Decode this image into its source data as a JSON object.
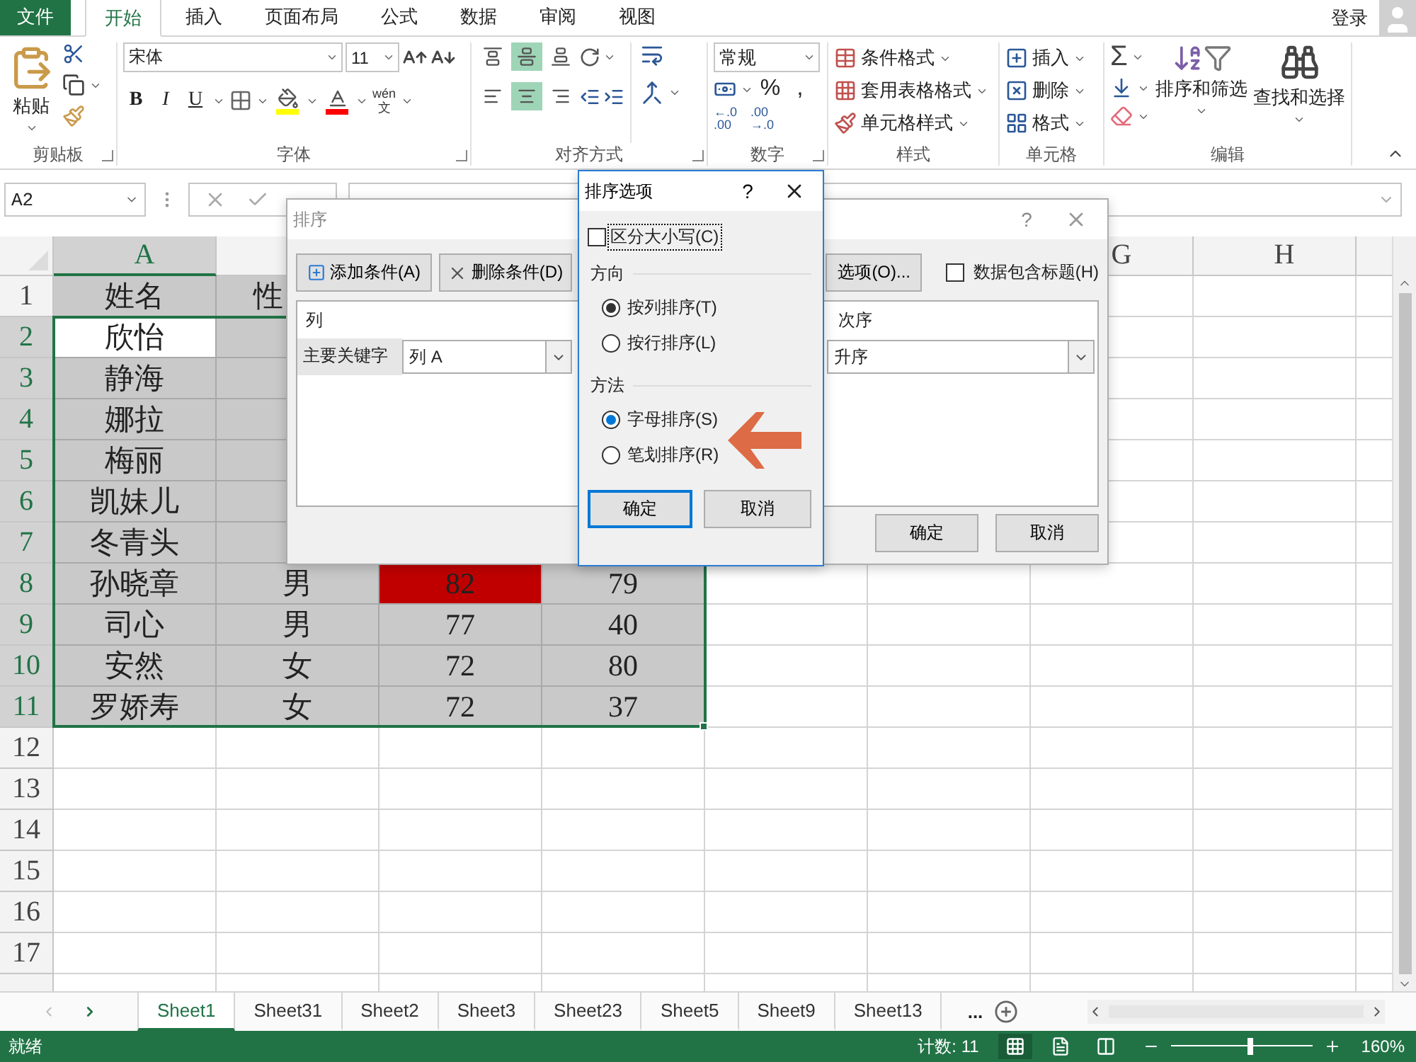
{
  "menu_tabs": [
    {
      "label": "文件",
      "kind": "file",
      "selected": false
    },
    {
      "label": "开始",
      "kind": "tab",
      "selected": true
    },
    {
      "label": "插入",
      "kind": "tab",
      "selected": false
    },
    {
      "label": "页面布局",
      "kind": "tab",
      "selected": false
    },
    {
      "label": "公式",
      "kind": "tab",
      "selected": false
    },
    {
      "label": "数据",
      "kind": "tab",
      "selected": false
    },
    {
      "label": "审阅",
      "kind": "tab",
      "selected": false
    },
    {
      "label": "视图",
      "kind": "tab",
      "selected": false
    }
  ],
  "account": {
    "label": "登录"
  },
  "ribbon": {
    "clipboard": {
      "label": "剪贴板",
      "paste": "粘贴"
    },
    "font": {
      "label": "字体",
      "font_name": "宋体",
      "font_size": "11",
      "bold": "B",
      "italic": "I",
      "underline": "U",
      "phonetic_top": "wén",
      "phonetic_bottom": "文"
    },
    "alignment": {
      "label": "对齐方式",
      "vertical_align": [
        false,
        true,
        false
      ],
      "horizontal_align": [
        false,
        true,
        false
      ]
    },
    "number": {
      "label": "数字",
      "format": "常规",
      "percent": "%",
      "comma": ",",
      "decimals": [
        {
          "top": "←.0",
          "bottom": ".00"
        },
        {
          "top": ".00",
          "bottom": "→.0"
        }
      ]
    },
    "styles": {
      "label": "样式",
      "items": [
        "条件格式",
        "套用表格格式",
        "单元格样式"
      ]
    },
    "cells": {
      "label": "单元格",
      "items": [
        "插入",
        "删除",
        "格式"
      ]
    },
    "editing": {
      "label": "编辑",
      "sum": "Σ",
      "sort_filter": "排序和筛选",
      "find_select": "查找和选择"
    }
  },
  "name_box": "A2",
  "columns": [
    {
      "label": "A",
      "selected": true
    },
    {
      "selected": false
    },
    {},
    {},
    {},
    {},
    {
      "label": "G",
      "selected": false
    },
    {
      "label": "H",
      "selected": false
    }
  ],
  "rows": [
    {
      "number": "1",
      "selected": false,
      "cells": [
        {
          "text": "姓名",
          "shaded": true
        },
        {
          "text": "性",
          "shaded": true
        },
        {},
        {}
      ]
    },
    {
      "number": "2",
      "selected": true,
      "cells": [
        {
          "text": "欣怡",
          "active": true
        },
        {
          "shaded": true
        },
        {},
        {}
      ]
    },
    {
      "number": "3",
      "selected": true,
      "cells": [
        {
          "text": "静海",
          "shaded": true
        },
        {
          "shaded": true
        },
        {},
        {}
      ]
    },
    {
      "number": "4",
      "selected": true,
      "cells": [
        {
          "text": "娜拉",
          "shaded": true
        },
        {
          "shaded": true
        },
        {},
        {}
      ]
    },
    {
      "number": "5",
      "selected": true,
      "cells": [
        {
          "text": "梅丽",
          "shaded": true
        },
        {
          "shaded": true
        },
        {},
        {}
      ]
    },
    {
      "number": "6",
      "selected": true,
      "cells": [
        {
          "text": "凯妹儿",
          "shaded": true
        },
        {
          "shaded": true
        },
        {},
        {}
      ]
    },
    {
      "number": "7",
      "selected": true,
      "cells": [
        {
          "text": "冬青头",
          "shaded": true
        },
        {
          "shaded": true
        },
        {},
        {}
      ]
    },
    {
      "number": "8",
      "selected": true,
      "cells": [
        {
          "text": "孙晓章",
          "shaded": true
        },
        {
          "text": "男",
          "shaded": true
        },
        {
          "text": "82",
          "shaded": true,
          "color": "#c00000"
        },
        {
          "text": "79",
          "shaded": true
        }
      ]
    },
    {
      "number": "9",
      "selected": true,
      "cells": [
        {
          "text": "司心",
          "shaded": true
        },
        {
          "text": "男",
          "shaded": true
        },
        {
          "text": "77",
          "shaded": true
        },
        {
          "text": "40",
          "shaded": true
        }
      ]
    },
    {
      "number": "10",
      "selected": true,
      "cells": [
        {
          "text": "安然",
          "shaded": true
        },
        {
          "text": "女",
          "shaded": true
        },
        {
          "text": "72",
          "shaded": true
        },
        {
          "text": "80",
          "shaded": true
        }
      ]
    },
    {
      "number": "11",
      "selected": true,
      "cells": [
        {
          "text": "罗娇寿",
          "shaded": true
        },
        {
          "text": "女",
          "shaded": true
        },
        {
          "text": "72",
          "shaded": true
        },
        {
          "text": "37",
          "shaded": true
        }
      ]
    },
    {
      "number": "12",
      "selected": false,
      "cells": []
    },
    {
      "number": "13",
      "selected": false,
      "cells": []
    },
    {
      "number": "14",
      "selected": false,
      "cells": []
    },
    {
      "number": "15",
      "selected": false,
      "cells": []
    },
    {
      "number": "16",
      "selected": false,
      "cells": []
    },
    {
      "number": "17",
      "selected": false,
      "cells": []
    }
  ],
  "sheet_tabs": [
    {
      "label": "Sheet1",
      "selected": true
    },
    {
      "label": "Sheet31",
      "selected": false
    },
    {
      "label": "Sheet2",
      "selected": false
    },
    {
      "label": "Sheet3",
      "selected": false
    },
    {
      "label": "Sheet23",
      "selected": false
    },
    {
      "label": "Sheet5",
      "selected": false
    },
    {
      "label": "Sheet9",
      "selected": false
    },
    {
      "label": "Sheet13",
      "selected": false
    }
  ],
  "more_tabs": "...",
  "status_bar": {
    "state": "就绪",
    "count": "计数: 11",
    "zoom": {
      "level": 0.56,
      "text": "160%"
    }
  },
  "sort_dialog": {
    "title": "排序",
    "help": "?",
    "add_condition": "添加条件(A)",
    "delete_condition": "删除条件(D)",
    "options": "选项(O)...",
    "has_headers": {
      "label": "数据包含标题(H)",
      "checked": false
    },
    "column_header": "列",
    "order_header": "次序",
    "levels": [
      {
        "label": "主要关键字",
        "column": "列 A",
        "order": "升序"
      }
    ],
    "ok": "确定",
    "cancel": "取消"
  },
  "options_dialog": {
    "title": "排序选项",
    "help": "?",
    "case_sensitive": {
      "label": "区分大小写(C)",
      "checked": false
    },
    "sections": [
      {
        "title": "方向",
        "color": "#333333",
        "options": [
          {
            "label": "按列排序(T)",
            "selected": true
          },
          {
            "label": "按行排序(L)",
            "selected": false
          }
        ]
      },
      {
        "title": "方法",
        "color": "#0078d7",
        "options": [
          {
            "label": "字母排序(S)",
            "selected": true
          },
          {
            "label": "笔划排序(R)",
            "selected": false
          }
        ]
      }
    ],
    "ok": {
      "label": "确定",
      "default": true
    },
    "cancel": {
      "label": "取消",
      "default": false
    }
  }
}
